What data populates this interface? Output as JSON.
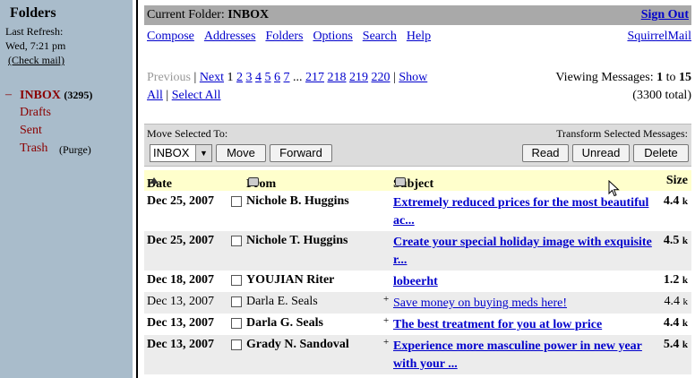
{
  "left": {
    "title": "Folders",
    "refresh_line1": "Last Refresh:",
    "refresh_line2": "Wed, 7:21 pm",
    "check_mail": "(Check mail)",
    "folders": [
      {
        "name": "INBOX",
        "count": "(3295)",
        "current": true
      },
      {
        "name": "Drafts"
      },
      {
        "name": "Sent"
      },
      {
        "name": "Trash",
        "extra": "(Purge)"
      }
    ]
  },
  "topbar": {
    "label": "Current Folder:",
    "folder": "INBOX",
    "sign_out": "Sign Out"
  },
  "menu": [
    "Compose",
    "Addresses",
    "Folders",
    "Options",
    "Search",
    "Help"
  ],
  "brand_link": "SquirrelMail",
  "pager": {
    "previous": "Previous",
    "next": "Next",
    "current": "1",
    "pages": [
      "2",
      "3",
      "4",
      "5",
      "6",
      "7"
    ],
    "ellipsis": "...",
    "pages_end": [
      "217",
      "218",
      "219",
      "220"
    ],
    "show": "Show",
    "all": "All",
    "select_all": "Select All"
  },
  "viewing": {
    "label": "Viewing Messages:",
    "from": "1",
    "to_word": "to",
    "to": "15",
    "total": "(3300 total)"
  },
  "actions": {
    "move_label": "Move Selected To:",
    "transform_label": "Transform Selected Messages:",
    "folder_select": "INBOX",
    "move": "Move",
    "forward": "Forward",
    "read": "Read",
    "unread": "Unread",
    "delete": "Delete"
  },
  "columns": {
    "date": "Date",
    "from": "From",
    "subject": "Subject",
    "size": "Size"
  },
  "messages": [
    {
      "date": "Dec 25, 2007",
      "from": "Nichole B. Huggins",
      "subject": "Extremely reduced prices for the most beautiful ac...",
      "size": "4.4",
      "unit": "k",
      "unread": true,
      "flag": ""
    },
    {
      "date": "Dec 25, 2007",
      "from": "Nichole T. Huggins",
      "subject": "Create your special holiday image with exquisite r...",
      "size": "4.5",
      "unit": "k",
      "unread": true,
      "flag": ""
    },
    {
      "date": "Dec 18, 2007",
      "from": "YOUJIAN Riter",
      "subject": "lobeerht",
      "size": "1.2",
      "unit": "k",
      "unread": true,
      "flag": ""
    },
    {
      "date": "Dec 13, 2007",
      "from": "Darla E. Seals",
      "subject": "Save money on buying meds here!",
      "size": "4.4",
      "unit": "k",
      "unread": false,
      "flag": "+"
    },
    {
      "date": "Dec 13, 2007",
      "from": "Darla G. Seals",
      "subject": "The best treatment for you at low price",
      "size": "4.4",
      "unit": "k",
      "unread": true,
      "flag": "+"
    },
    {
      "date": "Dec 13, 2007",
      "from": "Grady N. Sandoval",
      "subject": "Experience more masculine power in new year with your ...",
      "size": "5.4",
      "unit": "k",
      "unread": true,
      "flag": "+"
    }
  ]
}
